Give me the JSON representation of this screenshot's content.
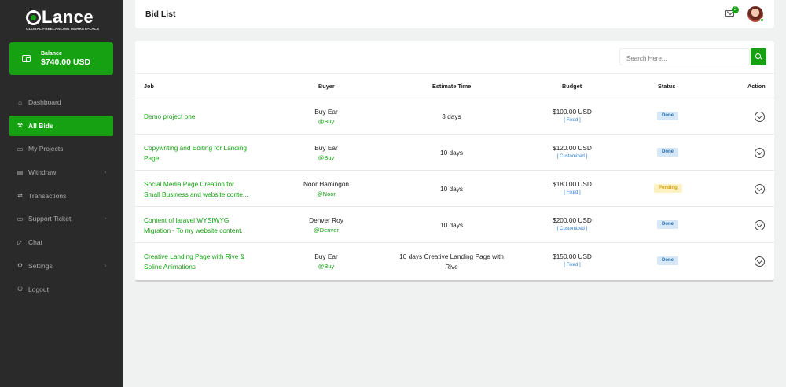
{
  "brand": {
    "name": "Lance",
    "tagline": "GLOBAL FREELANCING MARKETPLACE"
  },
  "balance": {
    "label": "Balance",
    "value": "$740.00 USD"
  },
  "nav": [
    {
      "label": "Dashboard",
      "icon": "home-icon",
      "active": false,
      "chevron": false
    },
    {
      "label": "All Bids",
      "icon": "gavel-icon",
      "active": true,
      "chevron": false
    },
    {
      "label": "My Projects",
      "icon": "folder-icon",
      "active": false,
      "chevron": false
    },
    {
      "label": "Withdraw",
      "icon": "card-icon",
      "active": false,
      "chevron": true
    },
    {
      "label": "Transactions",
      "icon": "exchange-icon",
      "active": false,
      "chevron": false
    },
    {
      "label": "Support Ticket",
      "icon": "ticket-icon",
      "active": false,
      "chevron": true
    },
    {
      "label": "Chat",
      "icon": "chat-icon",
      "active": false,
      "chevron": false
    },
    {
      "label": "Settings",
      "icon": "gear-icon",
      "active": false,
      "chevron": true
    },
    {
      "label": "Logout",
      "icon": "power-icon",
      "active": false,
      "chevron": false
    }
  ],
  "header": {
    "title": "Bid List",
    "mail_count": "2"
  },
  "search": {
    "placeholder": "Search Here..."
  },
  "table": {
    "columns": {
      "job": "Job",
      "buyer": "Buyer",
      "estimate": "Estimate Time",
      "budget": "Budget",
      "status": "Status",
      "action": "Action"
    },
    "rows": [
      {
        "job_line1": "Demo project one",
        "job_line2": "",
        "buyer": "Buy Ear",
        "handle": "@Buy",
        "est_line1": "3 days",
        "est_line2": "",
        "budget": "$100.00 USD",
        "budget_type": "[ Fixed ]",
        "status": "Done",
        "status_kind": "done"
      },
      {
        "job_line1": "Copywriting and Editing for Landing",
        "job_line2": "Page",
        "buyer": "Buy Ear",
        "handle": "@Buy",
        "est_line1": "10 days",
        "est_line2": "",
        "budget": "$120.00 USD",
        "budget_type": "[ Customized ]",
        "status": "Done",
        "status_kind": "done"
      },
      {
        "job_line1": "Social Media Page Creation for",
        "job_line2": "Small Business and website conte...",
        "buyer": "Noor Hamingon",
        "handle": "@Noor",
        "est_line1": "10 days",
        "est_line2": "",
        "budget": "$180.00 USD",
        "budget_type": "[ Fixed ]",
        "status": "Pending",
        "status_kind": "pending"
      },
      {
        "job_line1": "Content of laravel WYSIWYG",
        "job_line2": "Migration - To my website content.",
        "buyer": "Denver Roy",
        "handle": "@Denver",
        "est_line1": "10 days",
        "est_line2": "",
        "budget": "$200.00 USD",
        "budget_type": "[ Customized ]",
        "status": "Done",
        "status_kind": "done"
      },
      {
        "job_line1": "Creative Landing Page with Rive &",
        "job_line2": "Spline Animations",
        "buyer": "Buy Ear",
        "handle": "@Buy",
        "est_line1": "10 days Creative Landing Page with",
        "est_line2": "Rive",
        "budget": "$150.00 USD",
        "budget_type": "[ Fixed ]",
        "status": "Done",
        "status_kind": "done"
      }
    ]
  }
}
